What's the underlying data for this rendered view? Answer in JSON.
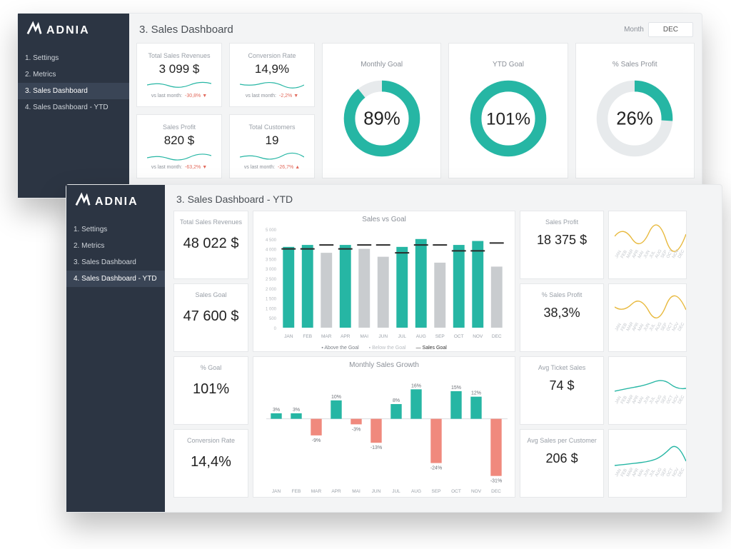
{
  "brand": "ADNIA",
  "month_label": "Month",
  "month_value": "DEC",
  "nav_items": [
    "1. Settings",
    "2. Metrics",
    "3. Sales Dashboard",
    "4. Sales Dashboard - YTD"
  ],
  "w1": {
    "title": "3. Sales Dashboard",
    "active_nav": 2,
    "kpi": [
      {
        "label": "Total Sales Revenues",
        "value": "3 099 $",
        "vs": "vs last month:",
        "delta": "-30,8%",
        "arrow": "▼"
      },
      {
        "label": "Conversion Rate",
        "value": "14,9%",
        "vs": "vs last month:",
        "delta": "-2,2%",
        "arrow": "▼"
      },
      {
        "label": "Sales Profit",
        "value": "820 $",
        "vs": "vs last month:",
        "delta": "-63,2%",
        "arrow": "▼"
      },
      {
        "label": "Total Customers",
        "value": "19",
        "vs": "vs last month:",
        "delta": "-26,7%",
        "arrow": "▲"
      }
    ],
    "donuts": [
      {
        "label": "Monthly Goal",
        "value": 89,
        "text": "89%"
      },
      {
        "label": "YTD Goal",
        "value": 101,
        "text": "101%"
      },
      {
        "label": "% Sales Profit",
        "value": 26,
        "text": "26%"
      }
    ]
  },
  "w2": {
    "title": "3. Sales Dashboard - YTD",
    "active_nav": 3,
    "left": [
      {
        "label": "Total Sales Revenues",
        "value": "48 022 $"
      },
      {
        "label": "Sales Goal",
        "value": "47 600 $"
      },
      {
        "label": "% Goal",
        "value": "101%"
      },
      {
        "label": "Conversion Rate",
        "value": "14,4%"
      }
    ],
    "right": [
      {
        "label": "Sales Profit",
        "value": "18 375 $"
      },
      {
        "label": "% Sales Profit",
        "value": "38,3%"
      },
      {
        "label": "Avg Ticket Sales",
        "value": "74 $"
      },
      {
        "label": "Avg Sales per Customer",
        "value": "206 $"
      }
    ],
    "months_short": [
      "JAN",
      "FEB",
      "MAR",
      "APR",
      "MAI",
      "JUN",
      "JUL",
      "AUG",
      "SEP",
      "OCT",
      "NOV",
      "DEC"
    ]
  },
  "chart_data": [
    {
      "type": "bar",
      "title": "Sales vs Goal",
      "categories": [
        "JAN",
        "FEB",
        "MAR",
        "APR",
        "MAI",
        "JUN",
        "JUL",
        "AUG",
        "SEP",
        "OCT",
        "NOV",
        "DEC"
      ],
      "series": [
        {
          "name": "Above the Goal",
          "values": [
            4100,
            4200,
            0,
            4200,
            0,
            0,
            4100,
            4500,
            0,
            4200,
            4400,
            0
          ]
        },
        {
          "name": "Below the Goal",
          "values": [
            0,
            0,
            3800,
            0,
            4000,
            3600,
            0,
            0,
            3300,
            0,
            0,
            3100
          ]
        },
        {
          "name": "Sales Goal",
          "values": [
            4000,
            4000,
            4200,
            4000,
            4200,
            4200,
            3800,
            4200,
            4200,
            3900,
            3900,
            4300
          ]
        }
      ],
      "ylim": [
        0,
        5000
      ],
      "yticks": [
        0,
        500,
        1000,
        1500,
        2000,
        2500,
        3000,
        3500,
        4000,
        4500,
        5000
      ],
      "legend": [
        "Above the Goal",
        "Below the Goal",
        "Sales Goal"
      ],
      "colors": {
        "Above the Goal": "#26b6a4",
        "Below the Goal": "#c9cccf",
        "Sales Goal": "#2b2b2b"
      }
    },
    {
      "type": "bar",
      "title": "Monthly Sales Growth",
      "categories": [
        "JAN",
        "FEB",
        "MAR",
        "APR",
        "MAI",
        "JUN",
        "JUL",
        "AUG",
        "SEP",
        "OCT",
        "NOV",
        "DEC"
      ],
      "values": [
        3,
        3,
        -9,
        10,
        -3,
        -13,
        8,
        16,
        -24,
        15,
        12,
        -31
      ],
      "ylim": [
        -35,
        20
      ],
      "value_suffix": "%",
      "colors": {
        "positive": "#26b6a4",
        "negative": "#f0897d"
      }
    }
  ]
}
